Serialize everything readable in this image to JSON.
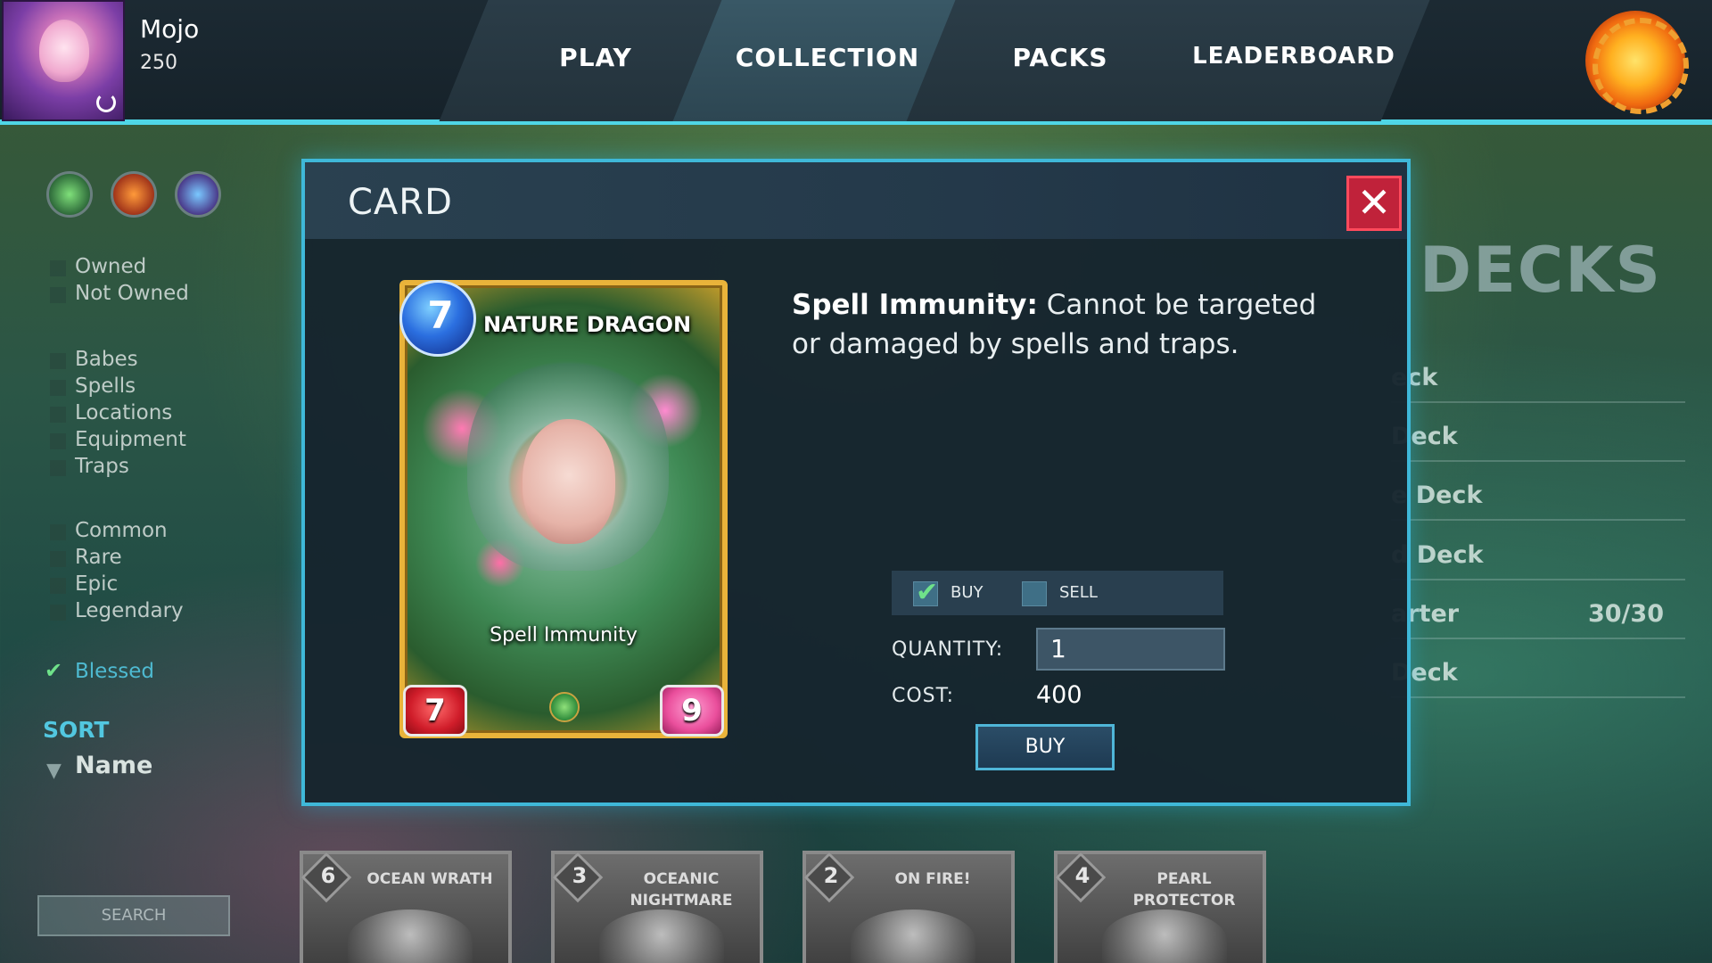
{
  "player": {
    "name": "Mojo",
    "coins": "250"
  },
  "nav": {
    "tabs": [
      {
        "label": "PLAY",
        "active": false
      },
      {
        "label": "COLLECTION",
        "active": true
      },
      {
        "label": "PACKS",
        "active": false
      },
      {
        "label": "LEADERBOARD",
        "active": false
      }
    ]
  },
  "filters": {
    "elements": [
      "nature-element-icon",
      "fire-element-icon",
      "water-element-icon"
    ],
    "ownership": [
      "Owned",
      "Not Owned"
    ],
    "types": [
      "Babes",
      "Spells",
      "Locations",
      "Equipment",
      "Traps"
    ],
    "rarities": [
      "Common",
      "Rare",
      "Epic",
      "Legendary"
    ],
    "blessed": "Blessed",
    "sort_title": "SORT",
    "sort_by": "Name",
    "search_placeholder": "SEARCH"
  },
  "decks": {
    "title": "DECKS",
    "rows": [
      {
        "name": "eck",
        "count": ""
      },
      {
        "name": "Deck",
        "count": ""
      },
      {
        "name": "e Deck",
        "count": ""
      },
      {
        "name": "d Deck",
        "count": ""
      },
      {
        "name": "arter",
        "count": "30/30"
      },
      {
        "name": "Deck",
        "count": ""
      }
    ]
  },
  "strip_cards": [
    {
      "cost": "6",
      "title": "OCEAN WRATH"
    },
    {
      "cost": "3",
      "title": "OCEANIC NIGHTMARE"
    },
    {
      "cost": "2",
      "title": "ON FIRE!"
    },
    {
      "cost": "4",
      "title": "PEARL PROTECTOR"
    }
  ],
  "modal": {
    "title": "CARD",
    "close_icon": "close-icon",
    "card": {
      "cost": "7",
      "name": "NATURE DRAGON",
      "ability": "Spell Immunity",
      "attack": "7",
      "health": "9",
      "element": "nature"
    },
    "description": {
      "keyword": "Spell Immunity:",
      "text": " Cannot be targeted or damaged by spells and traps."
    },
    "trade": {
      "buy_label": "BUY",
      "buy_checked": true,
      "sell_label": "SELL",
      "sell_checked": false,
      "quantity_label": "QUANTITY:",
      "quantity_value": "1",
      "cost_label": "COST:",
      "cost_value": "400",
      "buy_button": "BUY"
    }
  },
  "colors": {
    "accent": "#4fd6e6",
    "close_red": "#c0223a",
    "card_border_gold": "#e9b33a",
    "sort_blue": "#52c7e0"
  }
}
